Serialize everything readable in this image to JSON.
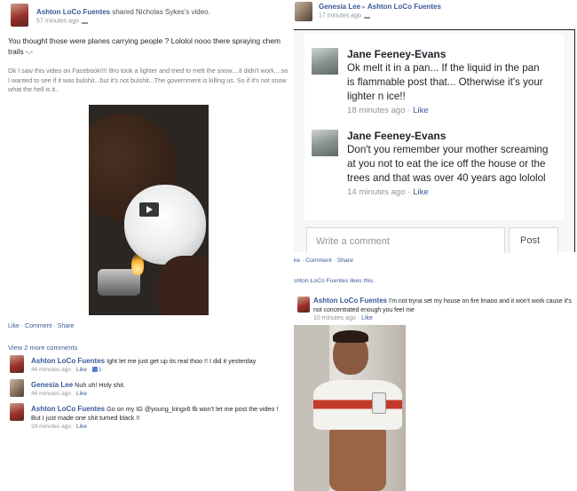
{
  "left_post": {
    "author": "Ashton LoCo Fuentes",
    "shared_text": "shared Nicholas Sykes's video.",
    "time": "57 minutes ago",
    "text": "You thought those were planes carrying people ? Lololol nooo there spraying chem trails -.-",
    "quote": "Ok I saw this video on Facebook!!!! Bro took a lighter and tried to melt the snow....it didn't work....so I wanted to see if it was bulshit...but it's not bulshit...The government is killing us. So if it's not snow what the hell is it..",
    "actions": [
      "Like",
      "Comment",
      "Share"
    ],
    "view_more": "View 2 more comments",
    "comments": [
      {
        "author": "Ashton LoCo Fuentes",
        "text": "Ight let me just get up its real thoo !! I did it yesterday",
        "time": "46 minutes ago",
        "like": "Like",
        "likes": "1"
      },
      {
        "author": "Genesia Lee",
        "text": "Nuh uh! Holy shit.",
        "time": "46 minutes ago",
        "like": "Like"
      },
      {
        "author": "Ashton LoCo Fuentes",
        "text": "Go on my IG @young_kingx6 fb won't let me post the video ! But I just made one shit turned black !!",
        "time": "29 minutes ago",
        "like": "Like"
      }
    ]
  },
  "right_header": {
    "author": "Genesia Lee",
    "arrow": "▸",
    "target": "Ashton LoCo Fuentes",
    "time": "17 minutes ago"
  },
  "zoom_comments": [
    {
      "author": "Jane Feeney-Evans",
      "text": "Ok melt it in a pan... If the liquid in the pan is flammable post that... Otherwise it's your lighter n ice!!",
      "time": "18 minutes ago",
      "like": "Like"
    },
    {
      "author": "Jane Feeney-Evans",
      "text": "Don't you remember your mother screaming at you not to eat the ice off the house or the trees and that was over 40 years ago lololol",
      "time": "14 minutes ago",
      "like": "Like"
    }
  ],
  "write_comment_placeholder": "Write a comment",
  "post_button": "Post",
  "right_actions": "ke · Comment · Share",
  "right_likes": "shton LoCo Fuentes likes this.",
  "right_comment": {
    "author": "Ashton LoCo Fuentes",
    "text": "I'm not tryna set my house on fire lmaoo and it won't work cause it's not concentrated enough you feel me",
    "time": "10 minutes ago",
    "like": "Like"
  },
  "separator": " · ",
  "icons": [
    "friends-icon",
    "play-icon",
    "like-thumb-icon"
  ],
  "colors": {
    "link": "#3b5998",
    "muted": "#90949c",
    "text": "#1d2129"
  }
}
